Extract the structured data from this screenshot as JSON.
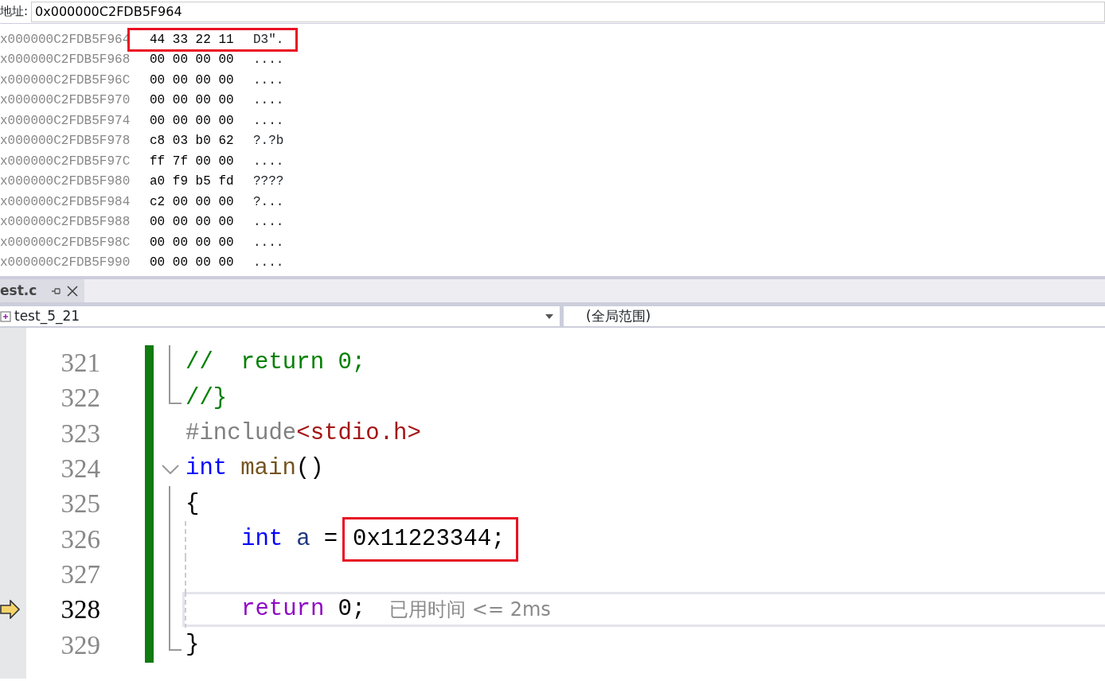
{
  "memory": {
    "address_label": "地址:",
    "address_value": "0x000000C2FDB5F964",
    "rows": [
      {
        "address": "x000000C2FDB5F964",
        "bytes": "44 33 22 11",
        "ascii": "D3″.",
        "highlighted": true
      },
      {
        "address": "x000000C2FDB5F968",
        "bytes": "00 00 00 00",
        "ascii": "....",
        "highlighted": false
      },
      {
        "address": "x000000C2FDB5F96C",
        "bytes": "00 00 00 00",
        "ascii": "....",
        "highlighted": false
      },
      {
        "address": "x000000C2FDB5F970",
        "bytes": "00 00 00 00",
        "ascii": "....",
        "highlighted": false
      },
      {
        "address": "x000000C2FDB5F974",
        "bytes": "00 00 00 00",
        "ascii": "....",
        "highlighted": false
      },
      {
        "address": "x000000C2FDB5F978",
        "bytes": "c8 03 b0 62",
        "ascii": "?.?b",
        "highlighted": false
      },
      {
        "address": "x000000C2FDB5F97C",
        "bytes": "ff 7f 00 00",
        "ascii": "....",
        "highlighted": false
      },
      {
        "address": "x000000C2FDB5F980",
        "bytes": "a0 f9 b5 fd",
        "ascii": "????",
        "highlighted": false
      },
      {
        "address": "x000000C2FDB5F984",
        "bytes": "c2 00 00 00",
        "ascii": "?...",
        "highlighted": false
      },
      {
        "address": "x000000C2FDB5F988",
        "bytes": "00 00 00 00",
        "ascii": "....",
        "highlighted": false
      },
      {
        "address": "x000000C2FDB5F98C",
        "bytes": "00 00 00 00",
        "ascii": "....",
        "highlighted": false
      },
      {
        "address": "x000000C2FDB5F990",
        "bytes": "00 00 00 00",
        "ascii": "....",
        "highlighted": false
      }
    ]
  },
  "tabs": [
    {
      "label": "est.c",
      "selected": true
    }
  ],
  "navigation": {
    "scope": "test_5_21",
    "member": "(全局范围)"
  },
  "editor": {
    "lines": [
      {
        "number": "321",
        "modified": true,
        "kind": "guide",
        "tokens": [
          {
            "text": "//  return 0;",
            "kind": "comment"
          }
        ]
      },
      {
        "number": "322",
        "modified": true,
        "kind": "guide-end",
        "tokens": [
          {
            "text": "//}",
            "kind": "comment"
          }
        ]
      },
      {
        "number": "323",
        "modified": true,
        "kind": "plain",
        "tokens": [
          {
            "text": "#include",
            "kind": "preprocessor"
          },
          {
            "text": "<stdio.h>",
            "kind": "string"
          }
        ]
      },
      {
        "number": "324",
        "modified": true,
        "kind": "toggle",
        "tokens": [
          {
            "text": "int",
            "kind": "keyword"
          },
          {
            "text": "main",
            "kind": "function",
            "spaced": true
          },
          {
            "text": "()",
            "kind": "plain"
          }
        ]
      },
      {
        "number": "325",
        "modified": true,
        "kind": "guide",
        "tokens": [
          {
            "text": "{",
            "kind": "plain"
          }
        ]
      },
      {
        "number": "326",
        "modified": true,
        "kind": "guide-indent",
        "tokens": [
          {
            "text": "int",
            "kind": "keyword",
            "indented": true
          },
          {
            "text": "a",
            "kind": "variable",
            "spaced": true
          },
          {
            "text": "=",
            "kind": "plain",
            "spaced": true
          },
          {
            "text": "0x11223344;",
            "kind": "plain",
            "spaced": true,
            "highlighted": true
          }
        ]
      },
      {
        "number": "327",
        "modified": true,
        "kind": "guide-indent"
      },
      {
        "number": "328",
        "current": true,
        "modified": true,
        "kind": "guide-indent",
        "tokens": [
          {
            "text": "return",
            "kind": "control",
            "indented": true
          },
          {
            "text": "0;",
            "kind": "plain",
            "spaced": true
          },
          {
            "text": "已用时间 <= 2ms",
            "kind": "hint"
          }
        ]
      },
      {
        "number": "329",
        "modified": true,
        "kind": "guide-end",
        "tokens": [
          {
            "text": "}",
            "kind": "plain"
          }
        ]
      }
    ]
  }
}
